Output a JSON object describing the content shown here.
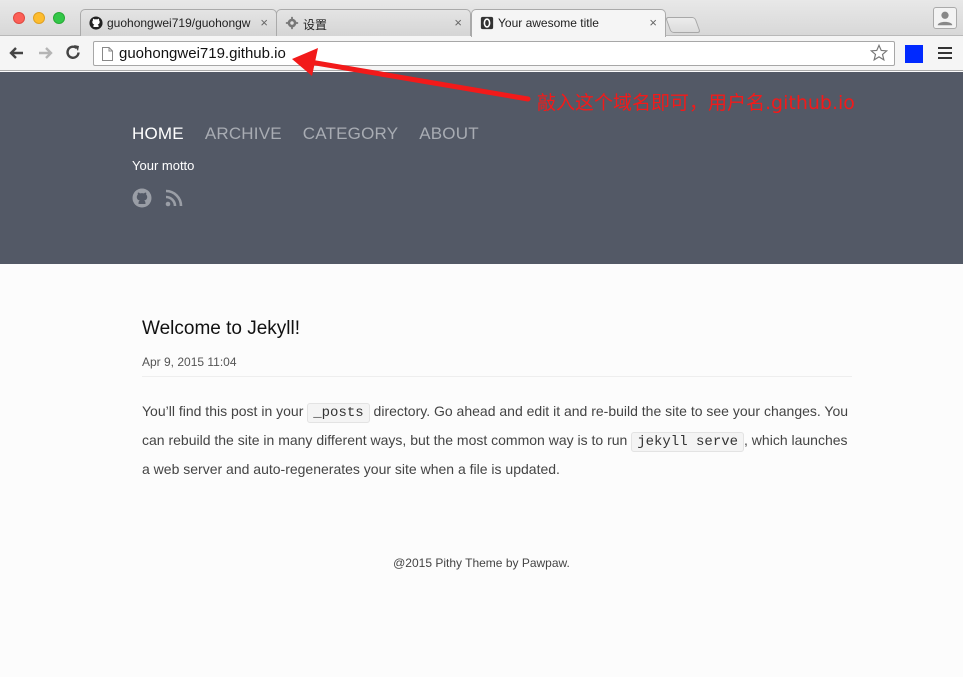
{
  "browser": {
    "tabs": [
      {
        "title": "guohongwei719/guohongw",
        "icon": "github-icon",
        "close": "×"
      },
      {
        "title": "设置",
        "icon": "gear-icon",
        "close": "×"
      },
      {
        "title": "Your awesome title",
        "icon": "page-o-icon",
        "close": "×"
      }
    ],
    "url": "guohongwei719.github.io",
    "extension_color": "#0029ff"
  },
  "annotation": {
    "text": "敲入这个域名即可，用户名.github.io",
    "color": "#f21a1a"
  },
  "site": {
    "nav": [
      "HOME",
      "ARCHIVE",
      "CATEGORY",
      "ABOUT"
    ],
    "motto": "Your motto",
    "header_color": "#535966"
  },
  "post": {
    "title": "Welcome to Jekyll!",
    "date": "Apr 9, 2015 11:04",
    "body": {
      "p1": "You’ll find this post in your ",
      "code1": "_posts",
      "p2": " directory. Go ahead and edit it and re-build the site to see your changes. You can rebuild the site in many different ways, but the most common way is to run ",
      "code2": "jekyll serve",
      "p3": ", which launches a web server and auto-regenerates your site when a file is updated."
    }
  },
  "footer": {
    "text": "@2015 Pithy Theme by Pawpaw."
  }
}
